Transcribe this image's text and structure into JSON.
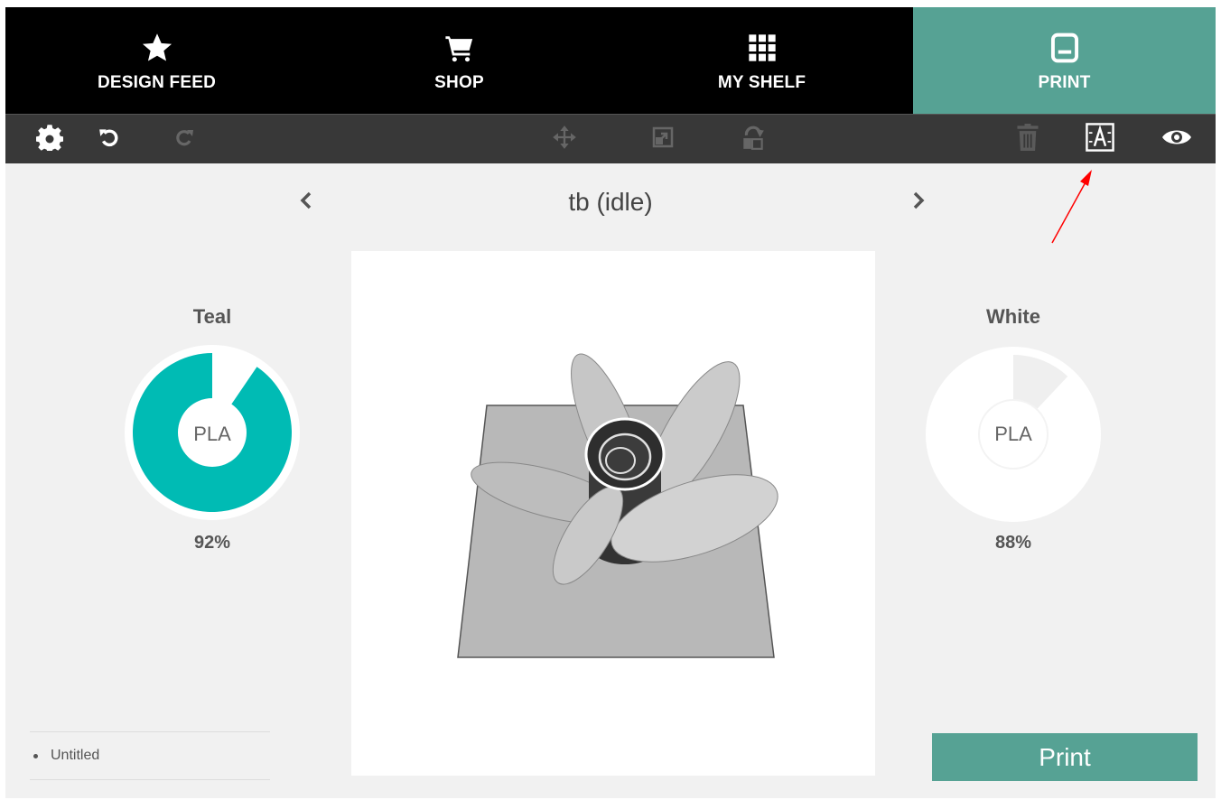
{
  "nav": {
    "tabs": [
      {
        "label": "DESIGN FEED",
        "icon": "star-icon"
      },
      {
        "label": "SHOP",
        "icon": "cart-icon"
      },
      {
        "label": "MY SHELF",
        "icon": "grid-icon"
      },
      {
        "label": "PRINT",
        "icon": "printer-icon",
        "active": true
      }
    ]
  },
  "toolbar": {
    "left": [
      "gear-icon",
      "undo-icon",
      "redo-icon"
    ],
    "center": [
      "move-icon",
      "scale-icon",
      "rotate-icon"
    ],
    "right": [
      "trash-icon",
      "text-label-icon",
      "eye-icon"
    ]
  },
  "printer": {
    "name": "tb (idle)"
  },
  "filaments": [
    {
      "color_name": "Teal",
      "material": "PLA",
      "percent_label": "92%",
      "fraction": 0.92,
      "color": "#00bbb4"
    },
    {
      "color_name": "White",
      "material": "PLA",
      "percent_label": "88%",
      "fraction": 0.88,
      "color": "#ffffff"
    }
  ],
  "jobs": [
    {
      "name": "Untitled"
    }
  ],
  "actions": {
    "print_label": "Print"
  },
  "colors": {
    "accent": "#56a294",
    "nav_bg": "#000000",
    "toolbar_bg": "#383838",
    "annotation": "#ff0000"
  }
}
